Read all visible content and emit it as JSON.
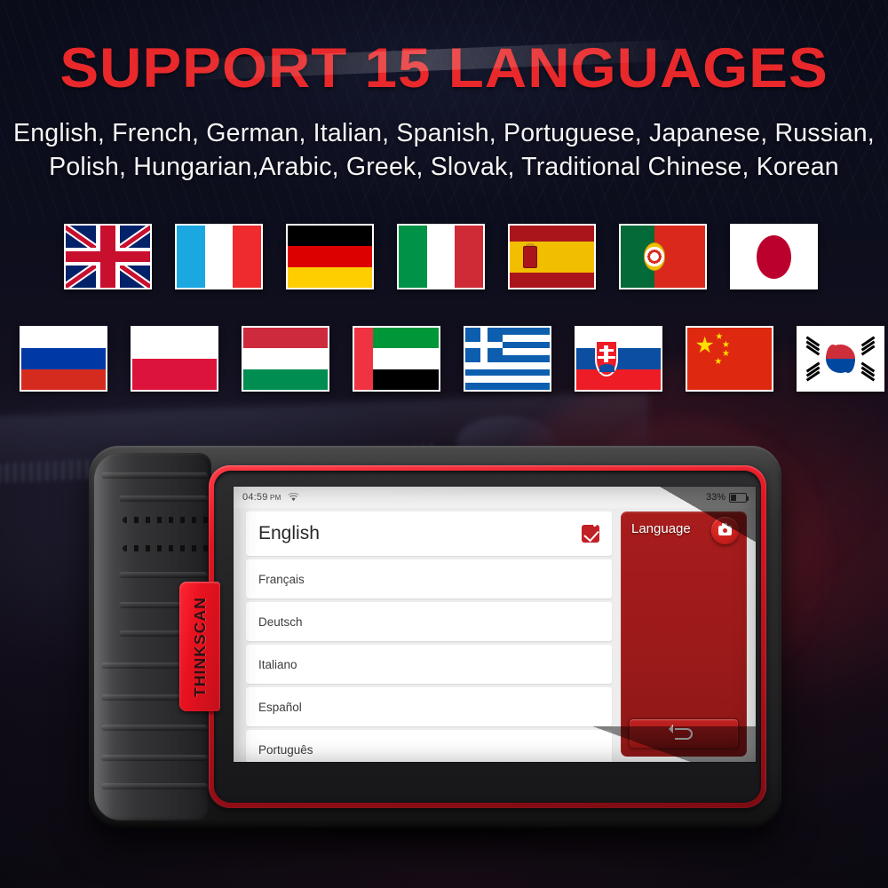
{
  "header": {
    "title": "SUPPORT 15 LANGUAGES",
    "subtitle_line1": "English, French, German, Italian, Spanish, Portuguese, Japanese, Russian,",
    "subtitle_line2": "Polish, Hungarian,Arabic, Greek, Slovak, Traditional Chinese, Korean",
    "title_color": "#e8282b",
    "subtitle_color": "#f4f4f6"
  },
  "flags": {
    "row1": [
      {
        "name": "united-kingdom",
        "label": "United Kingdom"
      },
      {
        "name": "france",
        "label": "France"
      },
      {
        "name": "germany",
        "label": "Germany"
      },
      {
        "name": "italy",
        "label": "Italy"
      },
      {
        "name": "spain",
        "label": "Spain"
      },
      {
        "name": "portugal",
        "label": "Portugal"
      },
      {
        "name": "japan",
        "label": "Japan"
      }
    ],
    "row2": [
      {
        "name": "russia",
        "label": "Russia"
      },
      {
        "name": "poland",
        "label": "Poland"
      },
      {
        "name": "hungary",
        "label": "Hungary"
      },
      {
        "name": "united-arab-emirates",
        "label": "United Arab Emirates"
      },
      {
        "name": "greece",
        "label": "Greece"
      },
      {
        "name": "slovakia",
        "label": "Slovakia"
      },
      {
        "name": "china",
        "label": "China"
      },
      {
        "name": "south-korea",
        "label": "South Korea"
      }
    ]
  },
  "device": {
    "brand": "THINKSCAN",
    "brand_tab_color": "#e8121f",
    "bezel_color": "#c3101a"
  },
  "screen": {
    "statusbar": {
      "time": "04:59",
      "ampm": "PM",
      "wifi_icon": "wifi-icon",
      "battery_percent": "33%",
      "battery_level": 33,
      "battery_icon": "battery-icon"
    },
    "language_list": [
      {
        "label": "English",
        "selected": true
      },
      {
        "label": "Français",
        "selected": false
      },
      {
        "label": "Deutsch",
        "selected": false
      },
      {
        "label": "Italiano",
        "selected": false
      },
      {
        "label": "Español",
        "selected": false
      },
      {
        "label": "Português",
        "selected": false
      }
    ],
    "side_panel": {
      "title": "Language",
      "camera_button_icon": "camera-icon",
      "back_button_icon": "back-arrow-icon",
      "panel_color": "#a81c1c"
    }
  }
}
